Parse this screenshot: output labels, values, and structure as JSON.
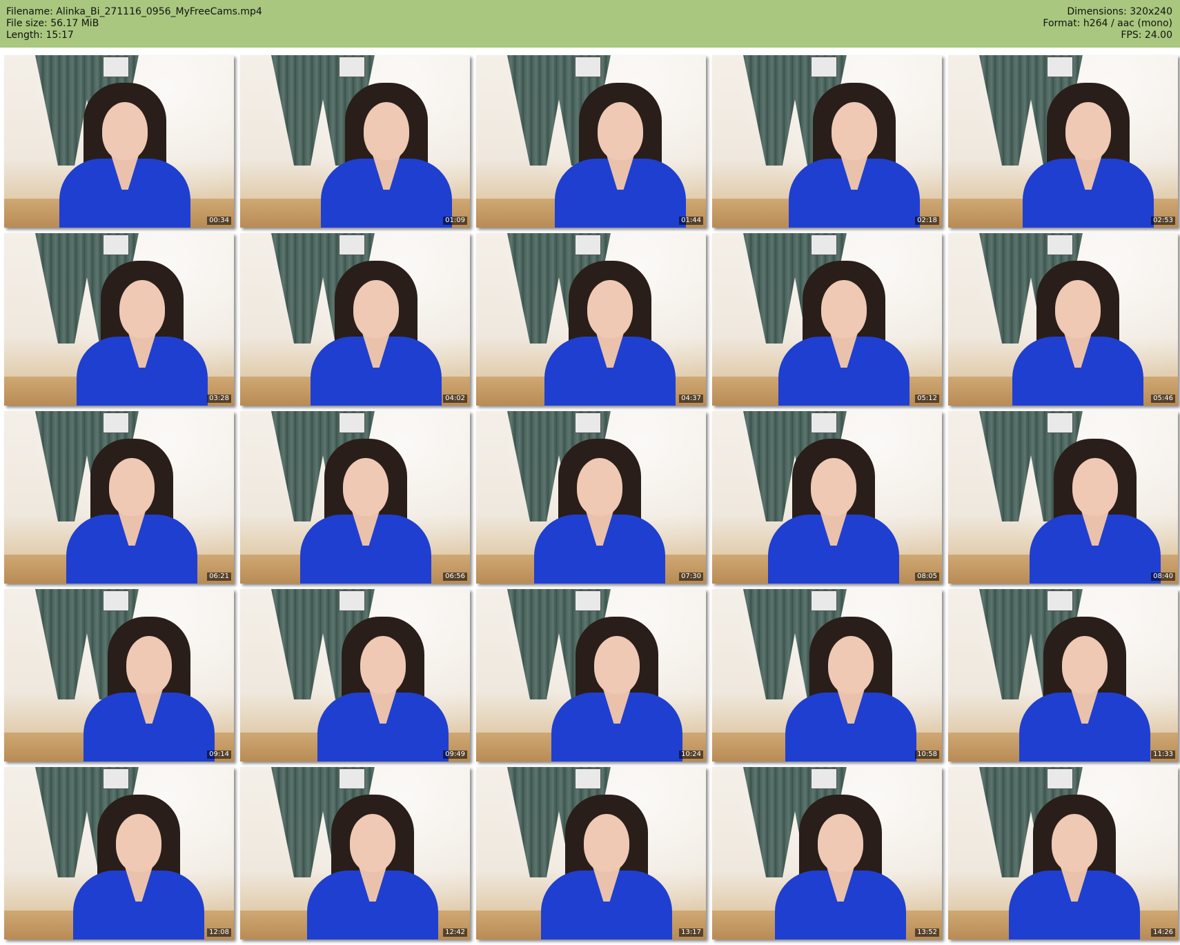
{
  "header": {
    "filename_line": "Filename: Alinka_Bi_271116_0956_MyFreeCams.mp4",
    "filesize_line": "File size: 56.17 MiB",
    "length_line": "Length: 15:17",
    "dimensions_line": "Dimensions: 320x240",
    "format_line": "Format: h264 / aac (mono)",
    "fps_line": "FPS: 24.00"
  },
  "colors": {
    "header_bg": "#a9c77f",
    "dress": "#1f3fd0",
    "curtain": "#3d5a52"
  },
  "thumbnails": [
    {
      "time": "00:34"
    },
    {
      "time": "01:09"
    },
    {
      "time": "01:44"
    },
    {
      "time": "02:18"
    },
    {
      "time": "02:53"
    },
    {
      "time": "03:28"
    },
    {
      "time": "04:02"
    },
    {
      "time": "04:37"
    },
    {
      "time": "05:12"
    },
    {
      "time": "05:46"
    },
    {
      "time": "06:21"
    },
    {
      "time": "06:56"
    },
    {
      "time": "07:30"
    },
    {
      "time": "08:05"
    },
    {
      "time": "08:40"
    },
    {
      "time": "09:14"
    },
    {
      "time": "09:49"
    },
    {
      "time": "10:24"
    },
    {
      "time": "10:58"
    },
    {
      "time": "11:33"
    },
    {
      "time": "12:08"
    },
    {
      "time": "12:42"
    },
    {
      "time": "13:17"
    },
    {
      "time": "13:52"
    },
    {
      "time": "14:26"
    }
  ]
}
